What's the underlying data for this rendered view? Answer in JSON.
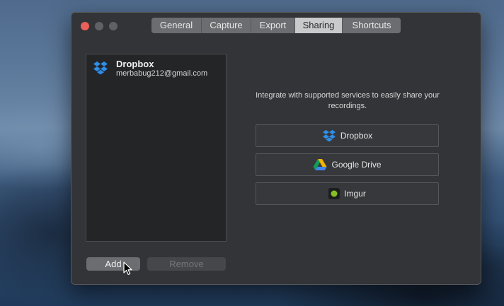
{
  "window": {
    "tabs": [
      {
        "label": "General",
        "active": false
      },
      {
        "label": "Capture",
        "active": false
      },
      {
        "label": "Export",
        "active": false
      },
      {
        "label": "Sharing",
        "active": true
      },
      {
        "label": "Shortcuts",
        "active": false
      }
    ]
  },
  "accounts": [
    {
      "service": "Dropbox",
      "email": "merbabug212@gmail.com",
      "icon": "dropbox-icon"
    }
  ],
  "sharing": {
    "intro": "Integrate with supported services to easily share your recordings.",
    "services": [
      {
        "label": "Dropbox",
        "icon": "dropbox-icon"
      },
      {
        "label": "Google Drive",
        "icon": "google-drive-icon"
      },
      {
        "label": "Imgur",
        "icon": "imgur-icon"
      }
    ]
  },
  "footer": {
    "add_label": "Add",
    "remove_label": "Remove"
  },
  "colors": {
    "close_button": "#ec5f5a",
    "dropbox_blue": "#2e8ee8",
    "imgur_green": "#85bf25",
    "window_bg": "#323437"
  }
}
